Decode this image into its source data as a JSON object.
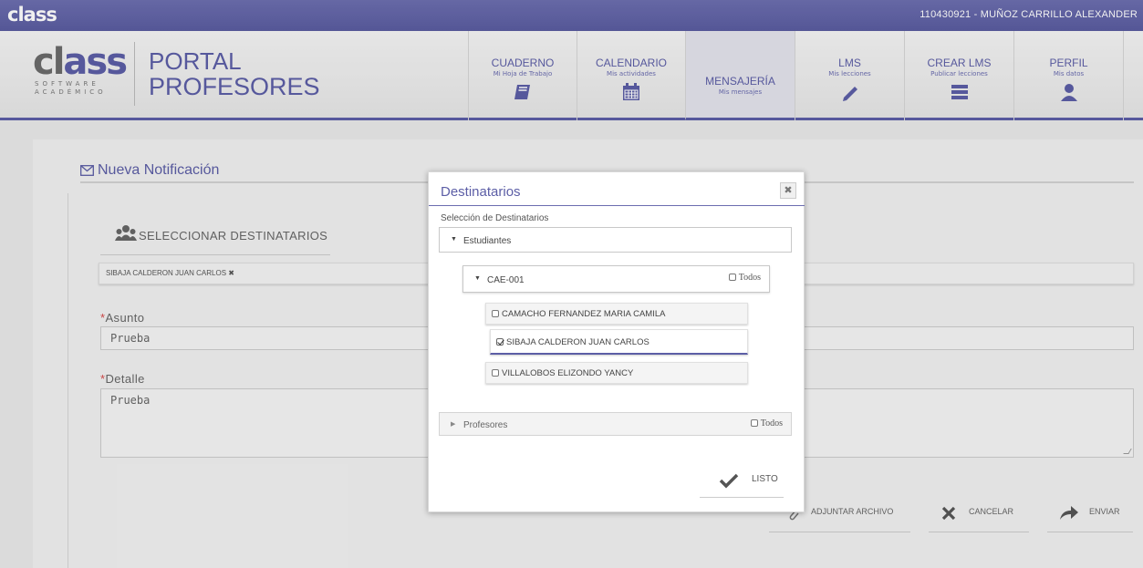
{
  "topbar": {
    "logo": "class",
    "user": "110430921 - MUÑOZ CARRILLO ALEXANDER"
  },
  "brand": {
    "logo_big": "class",
    "logo_sub1": "SOFTWARE",
    "logo_sub2": "ACADÉMICO",
    "portal_line1": "PORTAL",
    "portal_line2": "PROFESORES"
  },
  "nav": [
    {
      "title": "CUADERNO",
      "subtitle": "Mi Hoja de Trabajo",
      "icon": "book-icon"
    },
    {
      "title": "CALENDARIO",
      "subtitle": "Mis actividades",
      "icon": "calendar-icon"
    },
    {
      "title": "MENSAJERÍA",
      "subtitle": "Mis mensajes",
      "icon": ""
    },
    {
      "title": "LMS",
      "subtitle": "Mis lecciones",
      "icon": "pencil-icon"
    },
    {
      "title": "CREAR LMS",
      "subtitle": "Publicar lecciones",
      "icon": "list-icon"
    },
    {
      "title": "PERFIL",
      "subtitle": "Mis datos",
      "icon": "user-icon"
    }
  ],
  "form": {
    "title": "Nueva Notificación",
    "select_recipients": "SELECCIONAR DESTINATARIOS",
    "chip": "SIBAJA CALDERON JUAN CARLOS ✖",
    "asunto_label": "Asunto",
    "asunto_value": "Prueba",
    "detalle_label": "Detalle",
    "detalle_value": "Prueba",
    "required_mark": "*",
    "attach": "ADJUNTAR ARCHIVO",
    "cancel": "CANCELAR",
    "send": "ENVIAR"
  },
  "modal": {
    "title": "Destinatarios",
    "close": "✖",
    "subtitle": "Selección de Destinatarios",
    "group1": "Estudiantes",
    "section": "CAE-001",
    "todos": "Todos",
    "students": [
      {
        "name": "CAMACHO FERNANDEZ MARIA CAMILA",
        "checked": false
      },
      {
        "name": "SIBAJA CALDERON JUAN CARLOS",
        "checked": true
      },
      {
        "name": "VILLALOBOS ELIZONDO YANCY",
        "checked": false
      }
    ],
    "group2": "Profesores",
    "todos2": "Todos",
    "done": "LISTO"
  },
  "colors": {
    "accent": "#5c5ea6",
    "required": "#d54b4b"
  }
}
